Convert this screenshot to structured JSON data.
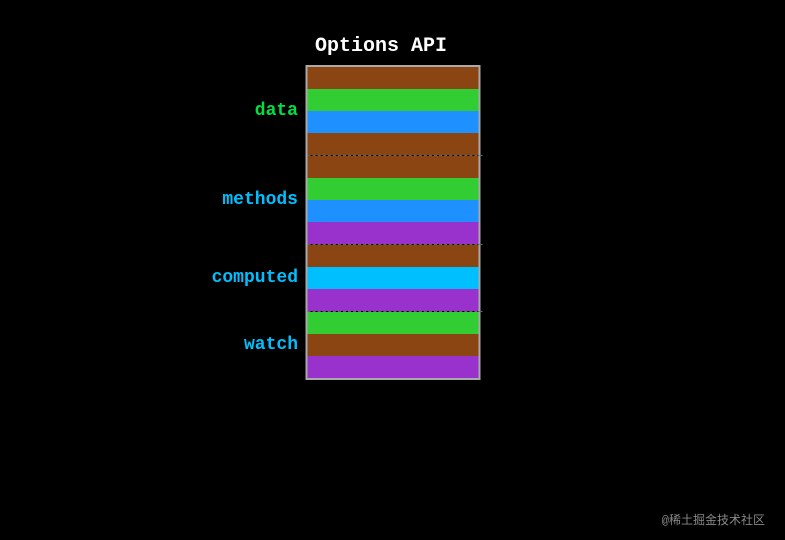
{
  "title": "Options API",
  "sections": [
    {
      "label": "data",
      "label_color": "#00e040",
      "bars": [
        {
          "color": "#8B4513"
        },
        {
          "color": "#32CD32"
        },
        {
          "color": "#1E90FF"
        },
        {
          "color": "#8B4513"
        }
      ]
    },
    {
      "label": "methods",
      "label_color": "#00bfff",
      "bars": [
        {
          "color": "#8B4513"
        },
        {
          "color": "#32CD32"
        },
        {
          "color": "#1E90FF"
        },
        {
          "color": "#9932CC"
        }
      ]
    },
    {
      "label": "computed",
      "label_color": "#00bfff",
      "bars": [
        {
          "color": "#8B4513"
        },
        {
          "color": "#00BFFF"
        },
        {
          "color": "#9932CC"
        }
      ]
    },
    {
      "label": "watch",
      "label_color": "#00bfff",
      "bars": [
        {
          "color": "#32CD32"
        },
        {
          "color": "#8B4513"
        },
        {
          "color": "#9932CC"
        }
      ]
    }
  ],
  "watermark": "@稀土掘金技术社区"
}
